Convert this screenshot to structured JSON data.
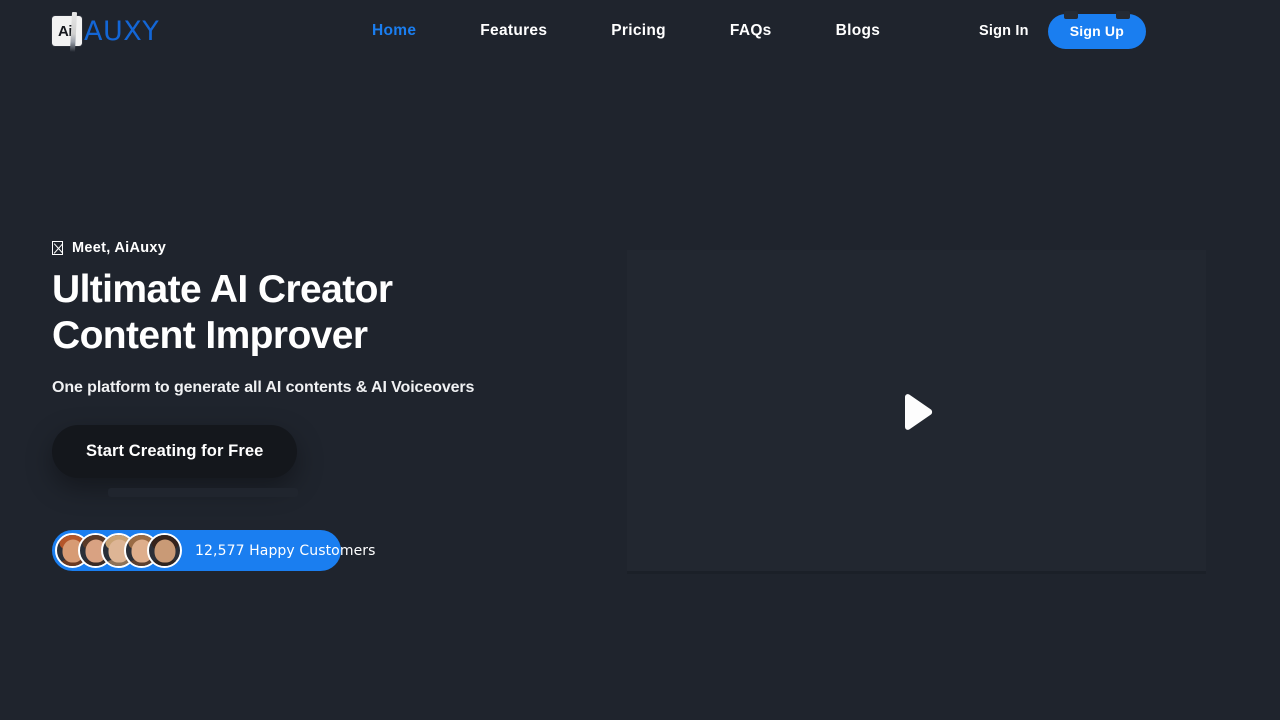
{
  "theme": {
    "page_bg": "#1f242d",
    "accent": "#1a7ef0",
    "text": "#ffffff",
    "cta_bg": "#14171c",
    "video_bg": "#222730"
  },
  "header": {
    "logo": {
      "mark_text": "Ai",
      "word_text": "AUXY",
      "icon": "logo-mark-icon"
    },
    "nav": [
      {
        "label": "Home",
        "active": true
      },
      {
        "label": "Features",
        "active": false
      },
      {
        "label": "Pricing",
        "active": false
      },
      {
        "label": "FAQs",
        "active": false
      },
      {
        "label": "Blogs",
        "active": false
      }
    ],
    "sign_in_label": "Sign In",
    "sign_up_label": "Sign Up"
  },
  "hero": {
    "eyebrow": "Meet, AiAuxy",
    "eyebrow_icon": "missing-glyph-box-icon",
    "headline_line1": "Ultimate AI Creator",
    "headline_line2": "Content Improver",
    "subhead": "One platform to generate all AI contents & AI Voiceovers",
    "cta_label": "Start Creating for Free",
    "social_proof": {
      "count_text": "12,577 Happy Customers",
      "avatars": [
        {
          "name": "customer-avatar-1",
          "skin": "#d79b74",
          "hair": "#b4562a",
          "shoulder": "#6b3a22"
        },
        {
          "name": "customer-avatar-2",
          "skin": "#d9a282",
          "hair": "#5a3a28",
          "shoulder": "#3a2b26"
        },
        {
          "name": "customer-avatar-3",
          "skin": "#ddb595",
          "hair": "#c9a274",
          "shoulder": "#8d7258"
        },
        {
          "name": "customer-avatar-4",
          "skin": "#deae8c",
          "hair": "#9a6b44",
          "shoulder": "#5c4030"
        },
        {
          "name": "customer-avatar-5",
          "skin": "#c99a76",
          "hair": "#35231c",
          "shoulder": "#2e2420"
        }
      ]
    }
  },
  "video": {
    "play_icon": "play-triangle-icon",
    "state": "paused"
  }
}
